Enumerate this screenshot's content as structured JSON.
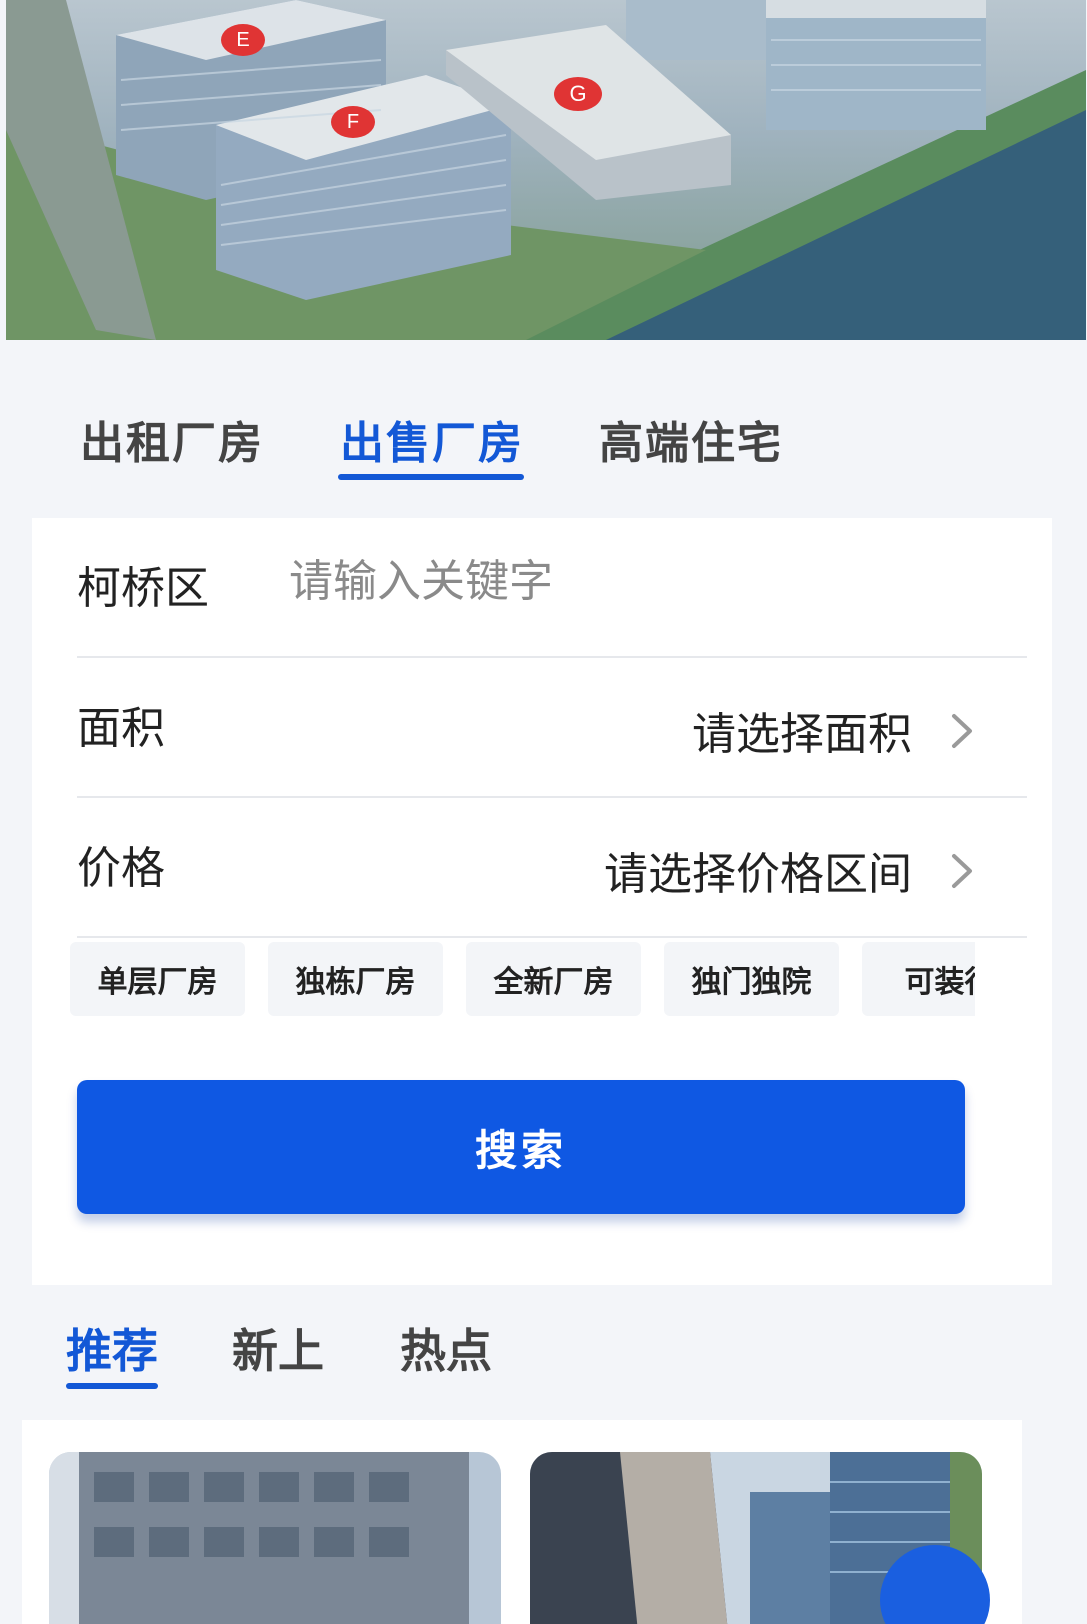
{
  "hero": {
    "building_markers": [
      "E",
      "F",
      "G"
    ]
  },
  "category_tabs": [
    {
      "label": "出租厂房",
      "active": false
    },
    {
      "label": "出售厂房",
      "active": true
    },
    {
      "label": "高端住宅",
      "active": false
    }
  ],
  "form": {
    "district_label": "柯桥区",
    "keyword_placeholder": "请输入关键字",
    "keyword_value": "",
    "area_label": "面积",
    "area_value": "请选择面积",
    "price_label": "价格",
    "price_value": "请选择价格区间",
    "chips": [
      "单层厂房",
      "独栋厂房",
      "全新厂房",
      "独门独院",
      "可装行"
    ],
    "search_label": "搜索"
  },
  "listing_tabs": [
    {
      "label": "推荐",
      "active": true
    },
    {
      "label": "新上",
      "active": false
    },
    {
      "label": "热点",
      "active": false
    }
  ],
  "colors": {
    "accent": "#1358d6",
    "button": "#0f58e3",
    "page_bg": "#f3f5f9"
  },
  "icons": {
    "chevron": "chevron-right-icon",
    "marker": "map-marker-icon"
  }
}
